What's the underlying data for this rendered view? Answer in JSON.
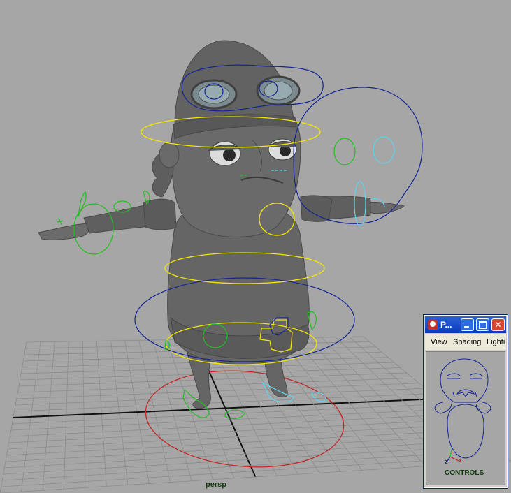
{
  "viewport": {
    "camera_label": "persp",
    "background_color": "#a6a6a6",
    "grid_color": "#8c8c8c",
    "grid_axis_color": "#111111"
  },
  "controls": {
    "colors": {
      "yellow": "#f2e600",
      "blue": "#142596",
      "green": "#20c020",
      "cyan": "#5dd3ef",
      "red": "#c62828"
    }
  },
  "panel": {
    "title": "P...",
    "menu": [
      "View",
      "Shading",
      "Lighti"
    ],
    "label": "CONTROLS",
    "axis_labels": {
      "x": "x",
      "z": "z"
    },
    "icons": {
      "app": "maya-icon",
      "minimize": "minimize-icon",
      "maximize": "maximize-icon",
      "close": "close-icon"
    }
  }
}
